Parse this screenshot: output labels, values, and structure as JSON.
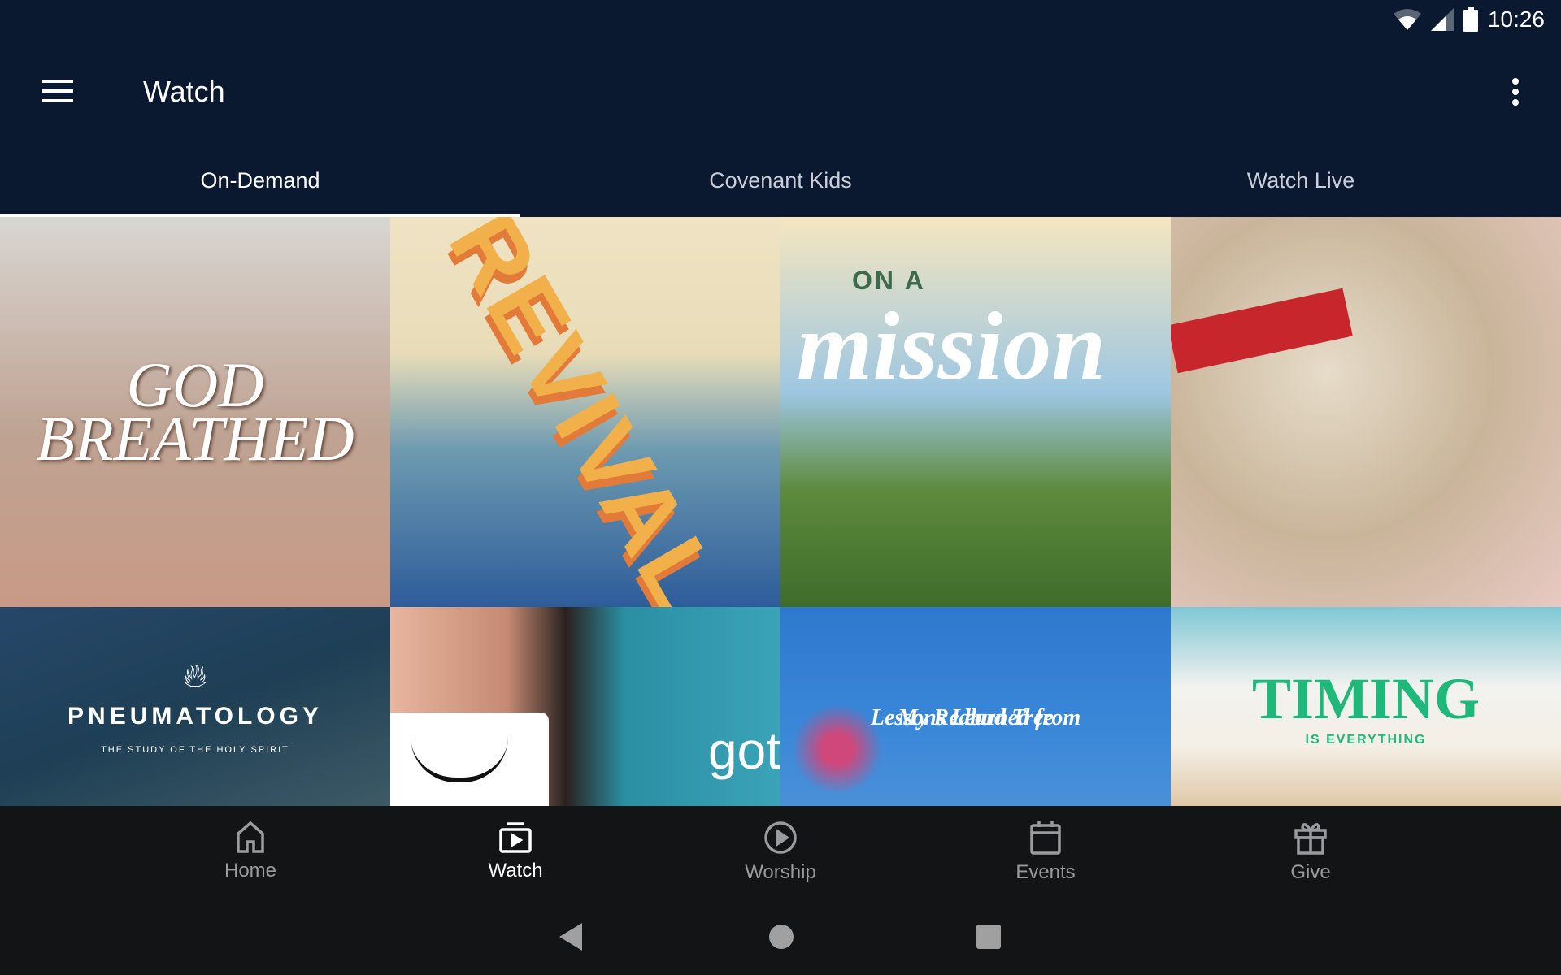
{
  "status": {
    "time": "10:26",
    "icons": [
      "wifi-icon",
      "signal-icon",
      "battery-icon"
    ]
  },
  "appbar": {
    "title": "Watch",
    "menu_icon": "hamburger-icon",
    "more_icon": "more-vert-icon"
  },
  "tabs": [
    {
      "label": "On-Demand",
      "active": true
    },
    {
      "label": "Covenant Kids"
    },
    {
      "label": "Watch Live"
    }
  ],
  "tiles": [
    {
      "l1": "GOD",
      "l2": "BREATHED"
    },
    {
      "l1": "REVIVAL"
    },
    {
      "l1": "ON A",
      "l2": "mission"
    },
    {
      "l1": ""
    },
    {
      "l1": "PNEUMATOLOGY",
      "l2": "THE STUDY OF THE HOLY SPIRIT"
    },
    {
      "l1": "got"
    },
    {
      "l1": "Lessons Learned from",
      "l2": "My Redbud Tree"
    },
    {
      "l1": "TIMING",
      "l2": "IS EVERYTHING"
    }
  ],
  "bottom_nav": [
    {
      "label": "Home",
      "icon": "home-icon"
    },
    {
      "label": "Watch",
      "icon": "watch-icon",
      "active": true
    },
    {
      "label": "Worship",
      "icon": "play-circle-icon"
    },
    {
      "label": "Events",
      "icon": "calendar-icon"
    },
    {
      "label": "Give",
      "icon": "gift-icon"
    }
  ],
  "colors": {
    "header": "#0b1930",
    "nav": "#131416",
    "active": "#ffffff",
    "inactive": "#9a9b9e"
  }
}
